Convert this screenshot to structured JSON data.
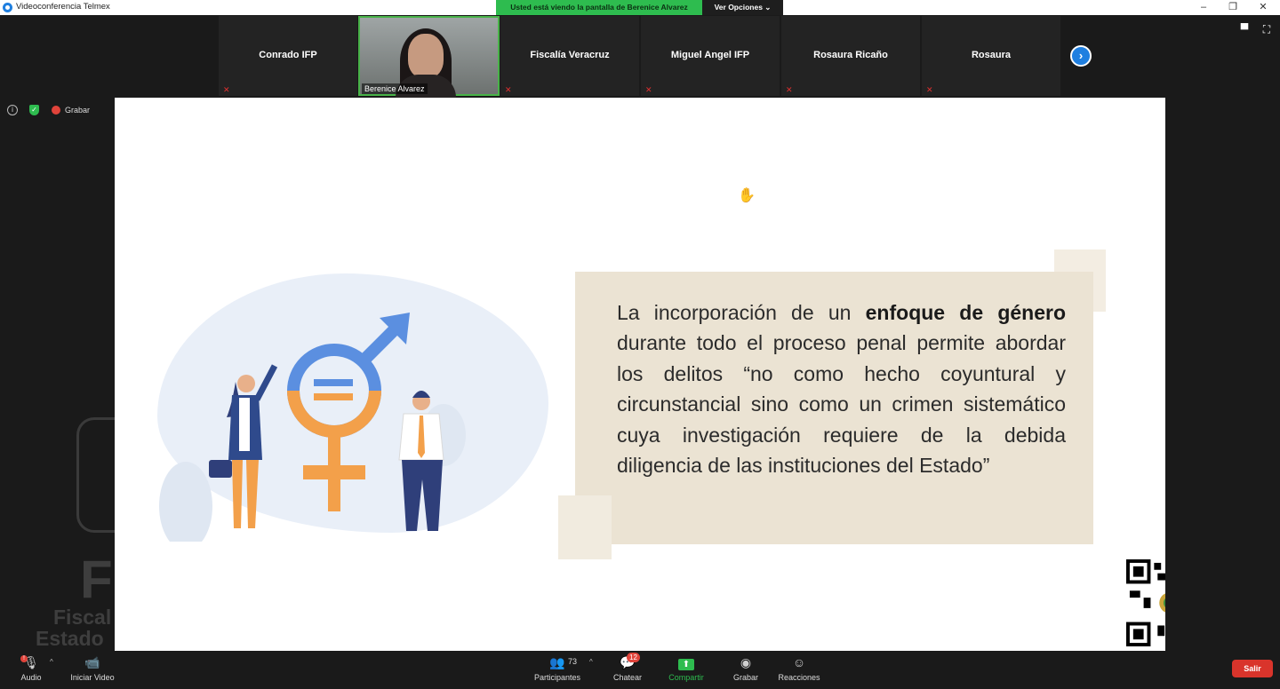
{
  "window": {
    "title": "Videoconferencia Telmex",
    "share_banner": "Usted está viendo la pantalla de Berenice Alvarez",
    "view_options": "Ver Opciones ⌄",
    "controls": {
      "minimize": "–",
      "restore": "❐",
      "close": "✕"
    }
  },
  "participants_strip": [
    {
      "name": "Conrado IFP",
      "type": "name"
    },
    {
      "name": "Berenice Alvarez",
      "type": "video"
    },
    {
      "name": "Fiscalía Veracruz",
      "type": "name"
    },
    {
      "name": "Miguel Angel IFP",
      "type": "name"
    },
    {
      "name": "Rosaura Ricaño",
      "type": "name"
    },
    {
      "name": "Rosaura",
      "type": "name"
    }
  ],
  "next_button": "›",
  "recording": {
    "label": "Grabar"
  },
  "background": {
    "letter": "F",
    "line1": "Fiscal",
    "line2": "Estado"
  },
  "slide": {
    "quote_parts": {
      "before": "La incorporación de un ",
      "bold": "enfoque de género",
      "after": " durante todo el proceso penal permite abordar los delitos “no como hecho coyuntural y circunstancial sino como un crimen sistemático cuya investigación requiere de la debida diligencia de las instituciones del Estado”"
    },
    "colors": {
      "blue": "#5b8fe0",
      "orange": "#f3a04a",
      "beige": "#ebe3d3",
      "navy": "#2f3f7a"
    }
  },
  "toolbar": {
    "audio": "Audio",
    "video": "Iniciar Video",
    "participants": "Participantes",
    "participants_count": "73",
    "chat": "Chatear",
    "chat_badge": "12",
    "share": "Compartir",
    "record": "Grabar",
    "reactions": "Reacciones",
    "exit": "Salir"
  }
}
